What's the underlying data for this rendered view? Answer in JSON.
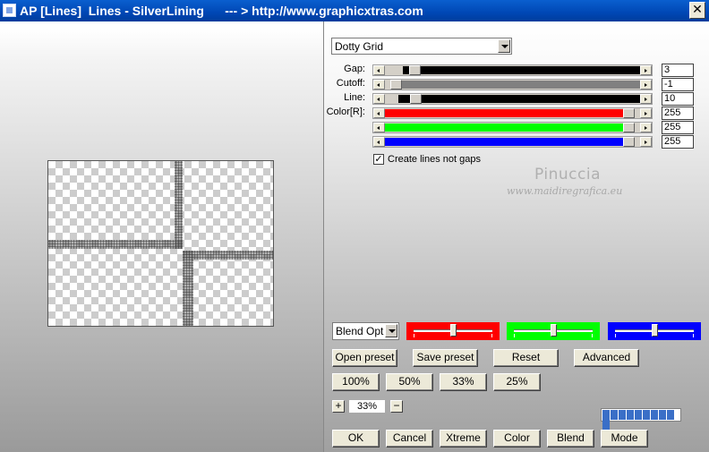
{
  "window": {
    "title": "AP [Lines]  Lines - SilverLining      --- > http://www.graphicxtras.com",
    "close_glyph": "✕",
    "icon": "app-icon"
  },
  "preset": {
    "selected": "Dotty Grid"
  },
  "params": [
    {
      "label": "Gap:",
      "value": "3",
      "fill_color": "#000000"
    },
    {
      "label": "Cutoff:",
      "value": "-1",
      "fill_color": "#808080"
    },
    {
      "label": "Line:",
      "value": "10",
      "fill_color": "#000000"
    },
    {
      "label": "Color[R]:",
      "value": "255",
      "fill_color": "#ff0000"
    },
    {
      "label": "",
      "value": "255",
      "fill_color": "#00ff00"
    },
    {
      "label": "",
      "value": "255",
      "fill_color": "#0000ff"
    }
  ],
  "create_lines": {
    "label": "Create lines not gaps",
    "checked": true,
    "check_glyph": "✓"
  },
  "watermark": {
    "line1": "Pinuccia",
    "line2": "www.maidiregrafica.eu"
  },
  "blend": {
    "selected": "Blend Optio",
    "colors": [
      "#ff0000",
      "#00ff00",
      "#0000ff"
    ],
    "levels": [
      0.5,
      0.5,
      0.5
    ]
  },
  "buttons": {
    "open_preset": "Open preset",
    "save_preset": "Save preset",
    "reset": "Reset",
    "advanced": "Advanced",
    "zoom100": "100%",
    "zoom50": "50%",
    "zoom33": "33%",
    "zoom25": "25%",
    "plus": "+",
    "minus": "−",
    "zoom_value": "33%",
    "ok": "OK",
    "cancel": "Cancel",
    "xtreme": "Xtreme",
    "color": "Color",
    "blend": "Blend",
    "mode": "Mode"
  },
  "progress": {
    "segments_filled": 10,
    "segments_total": 10
  }
}
